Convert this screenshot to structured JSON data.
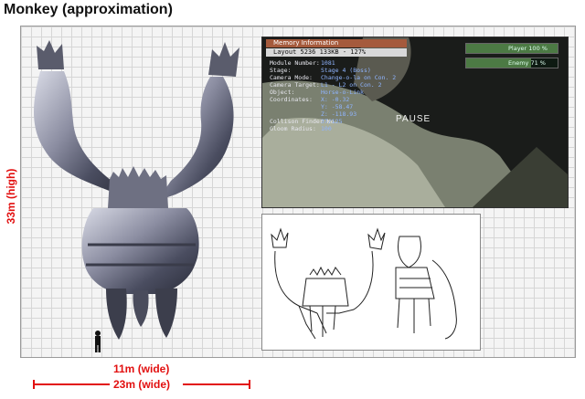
{
  "title": "Monkey (approximation)",
  "height_label": "33m (high)",
  "width_label_1": "11m (wide)",
  "width_label_2": "23m (wide)",
  "colors": {
    "accent": "#e21010",
    "grid": "#d6d6d6"
  },
  "game_screen": {
    "header": "Memory Information",
    "layout": "Layout  5236  133KB - 127%",
    "rows": [
      {
        "label": "Module Number:",
        "value": "1081"
      },
      {
        "label": "Stage:",
        "value": "Stage 4 (Boss)"
      },
      {
        "label": "Camera Mode:",
        "value": "Change-o-la on Con. 2"
      },
      {
        "label": "Camera Target:",
        "value": "L1 - L2 on Con. 2"
      },
      {
        "label": "Object:",
        "value": "Horse-o-Link"
      },
      {
        "label": "Coordinates:",
        "value": "X: -0.32"
      },
      {
        "label": "",
        "value": "Y: -58.47"
      },
      {
        "label": "",
        "value": "Z: -118.93"
      },
      {
        "label": "Collison Finder No:",
        "value": "37/125"
      },
      {
        "label": "Gloom Radius:",
        "value": "100"
      }
    ],
    "pause": "PAUSE",
    "player_bar": {
      "label": "Player  100 %",
      "level": 1.0
    },
    "enemy_bar": {
      "label": "Enemy    71 %",
      "level": 0.71
    }
  }
}
